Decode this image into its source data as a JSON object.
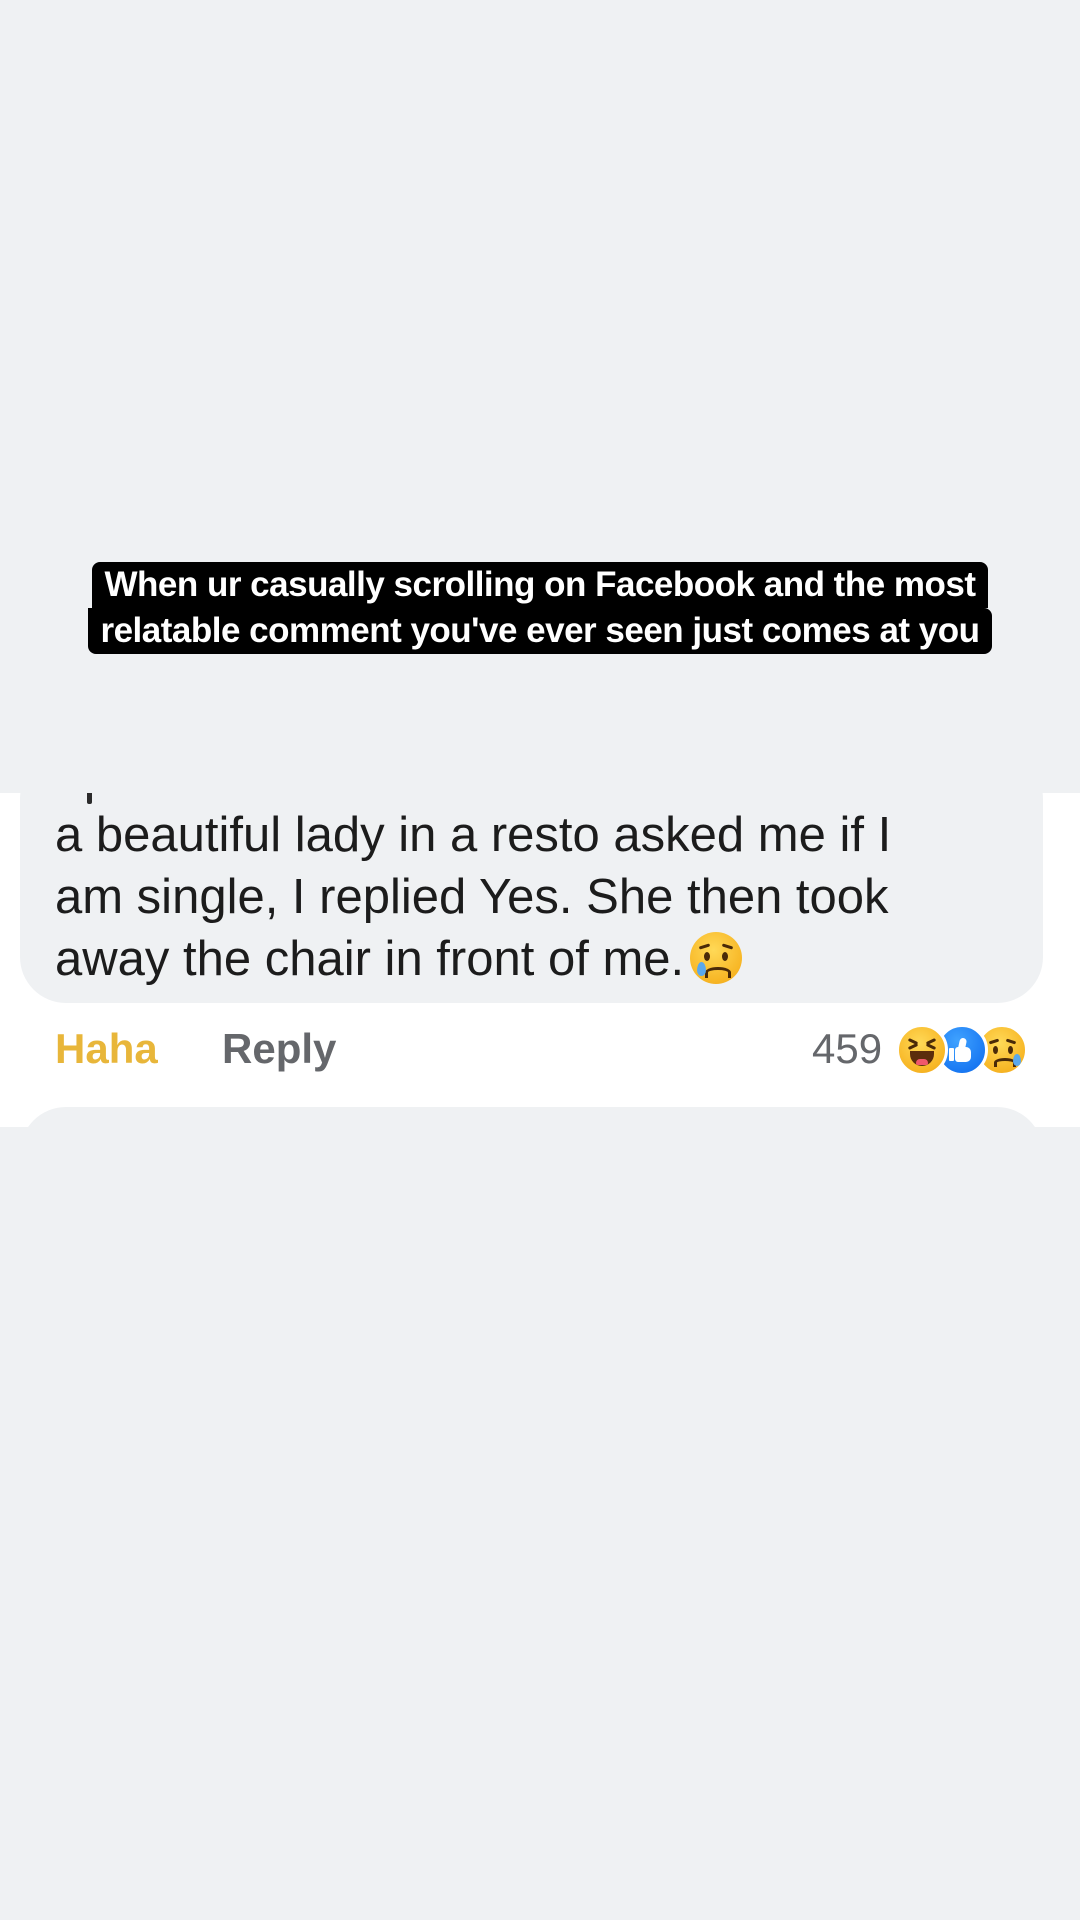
{
  "caption": {
    "line1": "When ur casually scrolling on Facebook and the most",
    "line2": "relatable comment you've ever seen just comes at you"
  },
  "comment": {
    "lines": [
      "a beautiful lady in a resto asked me if I",
      "am single, I replied Yes. She then took",
      "away the chair in front of me."
    ],
    "end_emoji": "sad-crying-emoji"
  },
  "actions": {
    "haha_label": "Haha",
    "reply_label": "Reply"
  },
  "reactions": {
    "count": "459",
    "icons": [
      "laughing-emoji",
      "like-thumb-icon",
      "sad-crying-emoji"
    ]
  },
  "colors": {
    "background": "#eff1f3",
    "bubble": "#eff1f3",
    "haha_active": "#e8b63a",
    "secondary_text": "#65676b",
    "like_blue": "#1877f2",
    "caption_bg": "#000000",
    "caption_text": "#ffffff"
  }
}
